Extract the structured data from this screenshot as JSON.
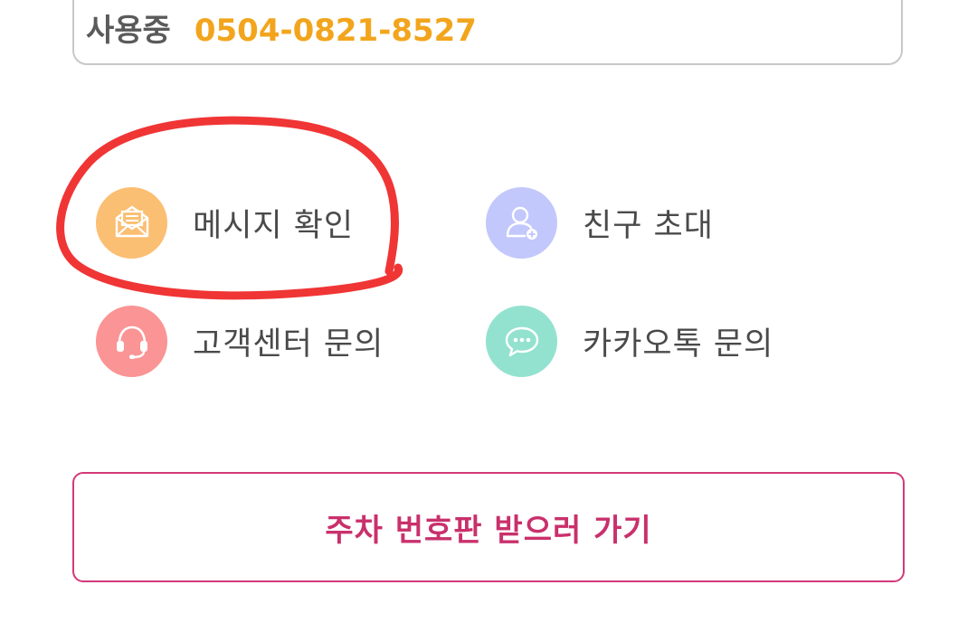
{
  "info_card": {
    "label": "사용중",
    "phone": "0504-0821-8527"
  },
  "menu": {
    "items": [
      {
        "label": "메시지 확인",
        "icon": "envelope-icon",
        "color": "#fbbf73"
      },
      {
        "label": "친구 초대",
        "icon": "add-user-icon",
        "color": "#c2c8fb"
      },
      {
        "label": "고객센터 문의",
        "icon": "headset-icon",
        "color": "#fb9494"
      },
      {
        "label": "카카오톡 문의",
        "icon": "chat-bubble-icon",
        "color": "#93e2cf"
      }
    ]
  },
  "cta": {
    "label": "주차 번호판 받으러 가기",
    "color": "#c9306c"
  },
  "annotation": {
    "color": "#f03535"
  }
}
